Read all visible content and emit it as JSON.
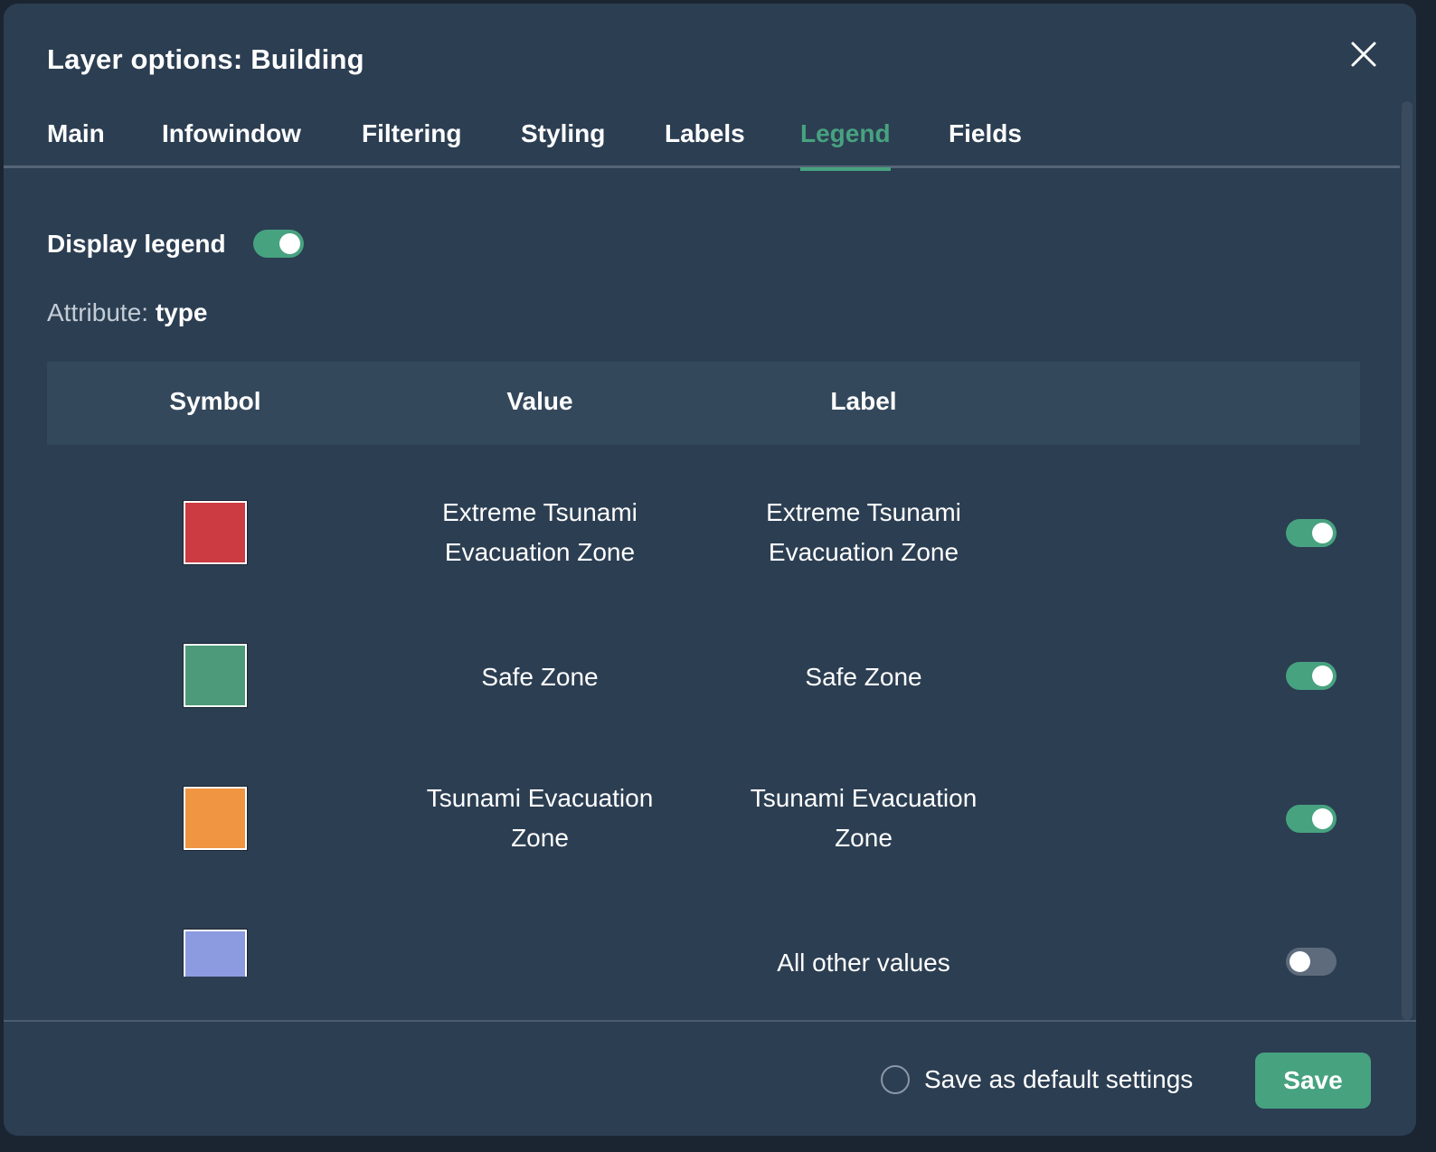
{
  "dialog": {
    "title": "Layer options: Building"
  },
  "tabs": [
    {
      "label": "Main",
      "active": false
    },
    {
      "label": "Infowindow",
      "active": false
    },
    {
      "label": "Filtering",
      "active": false
    },
    {
      "label": "Styling",
      "active": false
    },
    {
      "label": "Labels",
      "active": false
    },
    {
      "label": "Legend",
      "active": true
    },
    {
      "label": "Fields",
      "active": false
    }
  ],
  "legend": {
    "display_label": "Display legend",
    "display_enabled": true,
    "attribute_prefix": "Attribute:",
    "attribute_value": "type",
    "columns": {
      "symbol": "Symbol",
      "value": "Value",
      "label": "Label"
    },
    "rows": [
      {
        "color": "#cc3a42",
        "value": "Extreme Tsunami Evacuation Zone",
        "label": "Extreme Tsunami Evacuation Zone",
        "enabled": true
      },
      {
        "color": "#4c9a7a",
        "value": "Safe Zone",
        "label": "Safe Zone",
        "enabled": true
      },
      {
        "color": "#f09642",
        "value": "Tsunami Evacuation Zone",
        "label": "Tsunami Evacuation Zone",
        "enabled": true
      },
      {
        "color": "#8c9be0",
        "value": "",
        "label": "All other values",
        "enabled": false
      }
    ]
  },
  "footer": {
    "save_default_label": "Save as default settings",
    "save_default_checked": false,
    "save_label": "Save"
  },
  "colors": {
    "background": "#2c3e52",
    "accent": "#47a280",
    "table_header": "#34485c"
  },
  "icons": {
    "close": "close-icon"
  }
}
